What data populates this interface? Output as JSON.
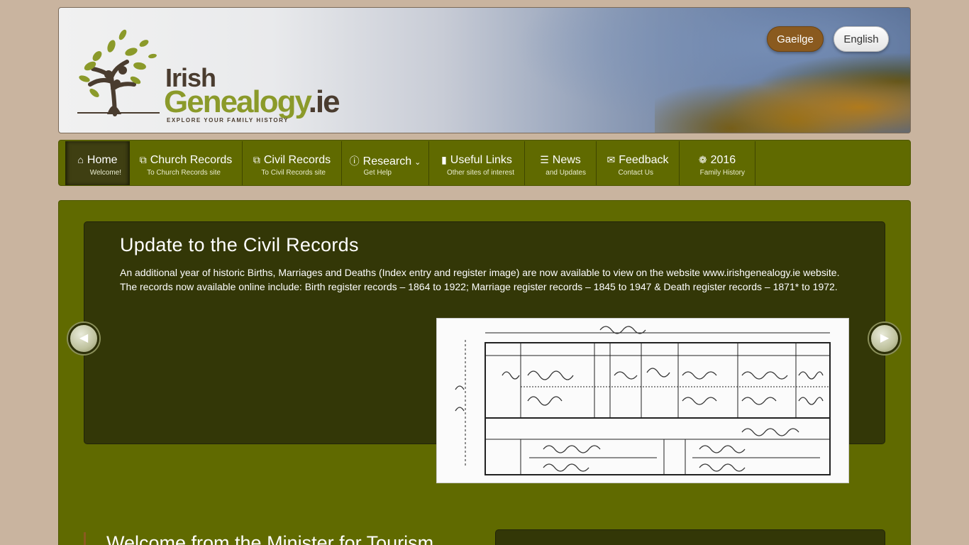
{
  "header": {
    "logo_word1": "Irish",
    "logo_word2": "Genealogy",
    "logo_suffix": ".ie",
    "logo_tagline": "EXPLORE YOUR FAMILY HISTORY",
    "lang_irish": "Gaeilge",
    "lang_english": "English"
  },
  "nav": {
    "items": [
      {
        "icon": "home-icon",
        "title": "Home",
        "sub": "Welcome!"
      },
      {
        "icon": "external-link-icon",
        "title": "Church Records",
        "sub": "To Church Records site"
      },
      {
        "icon": "external-link-icon",
        "title": "Civil Records",
        "sub": "To Civil Records site"
      },
      {
        "icon": "info-icon",
        "title": "Research",
        "sub": "Get Help"
      },
      {
        "icon": "bookmark-icon",
        "title": "Useful Links",
        "sub": "Other sites of interest"
      },
      {
        "icon": "list-icon",
        "title": "News",
        "sub": "and Updates"
      },
      {
        "icon": "envelope-icon",
        "title": "Feedback",
        "sub": "Contact Us"
      },
      {
        "icon": "book-icon",
        "title": "2016",
        "sub": "Family History"
      }
    ]
  },
  "slide": {
    "title": "Update to the Civil Records",
    "text": "An additional year of historic Births, Marriages and Deaths (Index entry and register image) are now available to view on the website www.irishgenealogy.ie website. The records now available online include: Birth register records – 1864 to 1922; Marriage register records – 1845 to 1947 & Death register records – 1871* to 1972."
  },
  "welcome": {
    "title": "Welcome from the Minister for Tourism"
  },
  "colors": {
    "nav_green": "#606a00",
    "slide_dark": "#333707",
    "accent_brown": "#8a5a1f",
    "page_bg": "#c9b49f"
  }
}
